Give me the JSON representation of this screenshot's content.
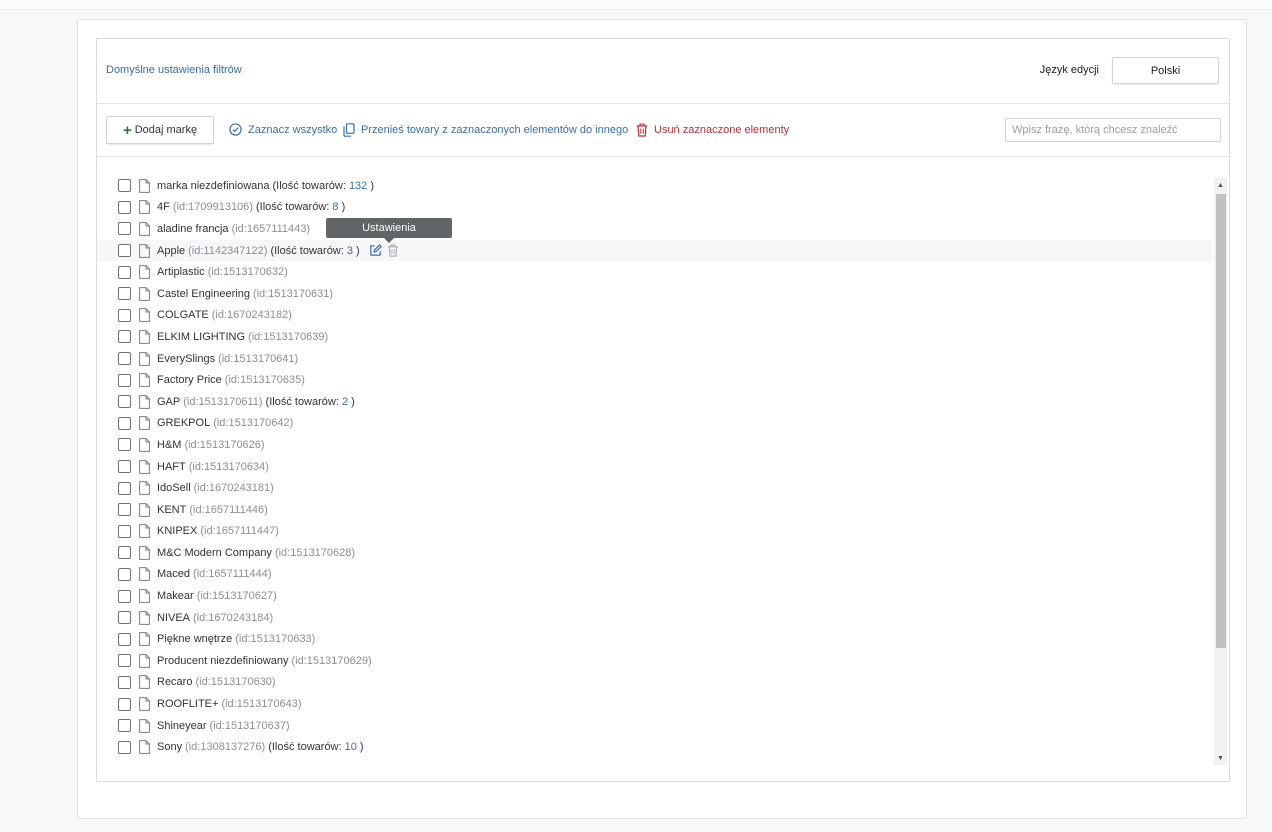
{
  "header": {
    "title": "Domyślne ustawienia filtrów",
    "language_label": "Język edycji",
    "language_value": "Polski"
  },
  "toolbar": {
    "add_label": "Dodaj markę",
    "select_all_label": "Zaznacz wszystko",
    "move_label": "Przenieś towary z zaznaczonych elementów do innego",
    "delete_label": "Usuń zaznaczone elementy",
    "search_placeholder": "Wpisz frazę, którą chcesz znaleźć"
  },
  "tooltip": "Ustawienia",
  "count_prefix": "(Ilość towarów:",
  "count_suffix": ")",
  "brands": [
    {
      "name": "marka niezdefiniowana",
      "id": "",
      "count": "132"
    },
    {
      "name": "4F",
      "id": "(id:1709913106)",
      "count": "8"
    },
    {
      "name": "aladine francja",
      "id": "(id:1657111443)",
      "count": ""
    },
    {
      "name": "Apple",
      "id": "(id:1142347122)",
      "count": "3"
    },
    {
      "name": "Artiplastic",
      "id": "(id:1513170632)",
      "count": ""
    },
    {
      "name": "Castel Engineering",
      "id": "(id:1513170631)",
      "count": ""
    },
    {
      "name": "COLGATE",
      "id": "(id:1670243182)",
      "count": ""
    },
    {
      "name": "ELKIM LIGHTING",
      "id": "(id:1513170639)",
      "count": ""
    },
    {
      "name": "EverySlings",
      "id": "(id:1513170641)",
      "count": ""
    },
    {
      "name": "Factory Price",
      "id": "(id:1513170635)",
      "count": ""
    },
    {
      "name": "GAP",
      "id": "(id:1513170611)",
      "count": "2"
    },
    {
      "name": "GREKPOL",
      "id": "(id:1513170642)",
      "count": ""
    },
    {
      "name": "H&M",
      "id": "(id:1513170626)",
      "count": ""
    },
    {
      "name": "HAFT",
      "id": "(id:1513170634)",
      "count": ""
    },
    {
      "name": "IdoSell",
      "id": "(id:1670243181)",
      "count": ""
    },
    {
      "name": "KENT",
      "id": "(id:1657111446)",
      "count": ""
    },
    {
      "name": "KNIPEX",
      "id": "(id:1657111447)",
      "count": ""
    },
    {
      "name": "M&C Modern Company",
      "id": "(id:1513170628)",
      "count": ""
    },
    {
      "name": "Maced",
      "id": "(id:1657111444)",
      "count": ""
    },
    {
      "name": "Makear",
      "id": "(id:1513170627)",
      "count": ""
    },
    {
      "name": "NIVEA",
      "id": "(id:1670243184)",
      "count": ""
    },
    {
      "name": "Piękne wnętrze",
      "id": "(id:1513170633)",
      "count": ""
    },
    {
      "name": "Producent niezdefiniowany",
      "id": "(id:1513170629)",
      "count": ""
    },
    {
      "name": "Recaro",
      "id": "(id:1513170630)",
      "count": ""
    },
    {
      "name": "ROOFLITE+",
      "id": "(id:1513170643)",
      "count": ""
    },
    {
      "name": "Shineyear",
      "id": "(id:1513170637)",
      "count": ""
    },
    {
      "name": "Sony",
      "id": "(id:1308137276)",
      "count": "10"
    }
  ],
  "colors": {
    "link": "#3a6ea5",
    "danger": "#b0303a",
    "add": "#2c7a3a"
  }
}
